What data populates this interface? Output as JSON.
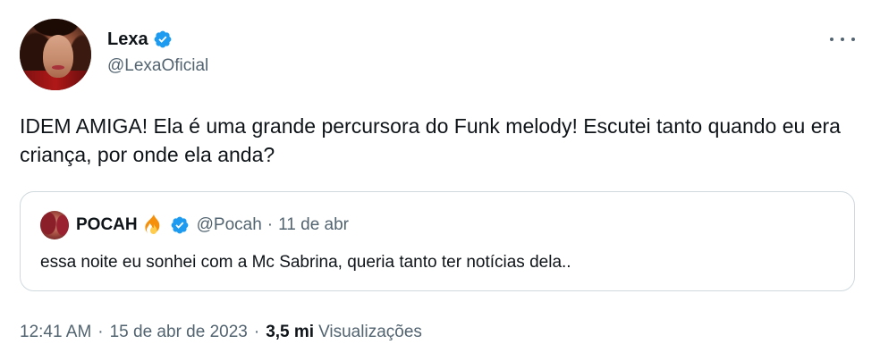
{
  "tweet": {
    "author": {
      "display_name": "Lexa",
      "handle": "@LexaOficial",
      "verified_icon": "verified-badge-icon"
    },
    "text": "IDEM AMIGA! Ela é uma grande percursora do Funk melody! Escutei tanto quando eu era criança, por onde ela anda?",
    "more_icon": "more-options-icon",
    "time": "12:41 AM",
    "date": "15 de abr de 2023",
    "separator": "·",
    "views_count": "3,5 mi",
    "views_label": "Visualizações"
  },
  "quoted": {
    "display_name": "POCAH",
    "emoji_icon": "fire-emoji-icon",
    "verified_icon": "verified-badge-icon",
    "handle": "@Pocah",
    "separator": "·",
    "date": "11 de abr",
    "text": "essa noite eu sonhei com a Mc Sabrina, queria tanto ter notícias dela.."
  },
  "colors": {
    "text_primary": "#0f1419",
    "text_secondary": "#536471",
    "verified_blue": "#1d9bf0",
    "border": "#cfd9de"
  }
}
